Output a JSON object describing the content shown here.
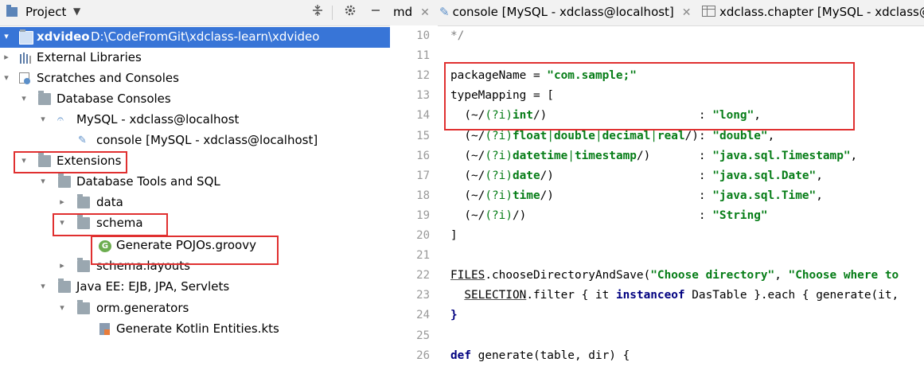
{
  "project_panel": {
    "title": "Project",
    "tree": [
      {
        "label": "xdvideo",
        "path": "D:\\CodeFromGit\\xdclass-learn\\xdvideo"
      },
      {
        "label": "External Libraries"
      },
      {
        "label": "Scratches and Consoles"
      },
      {
        "label": "Database Consoles"
      },
      {
        "label": "MySQL - xdclass@localhost"
      },
      {
        "label": "console [MySQL - xdclass@localhost]"
      },
      {
        "label": "Extensions"
      },
      {
        "label": "Database Tools and SQL"
      },
      {
        "label": "data"
      },
      {
        "label": "schema"
      },
      {
        "label": "Generate POJOs.groovy"
      },
      {
        "label": "schema.layouts"
      },
      {
        "label": "Java EE: EJB, JPA, Servlets"
      },
      {
        "label": "orm.generators"
      },
      {
        "label": "Generate Kotlin Entities.kts"
      }
    ],
    "icons": {
      "collapse_all": "collapse-all-icon",
      "settings": "gear-icon",
      "hide": "minimize-icon"
    }
  },
  "editor": {
    "tabs": [
      {
        "label": "md"
      },
      {
        "label": "console [MySQL - xdclass@localhost]"
      },
      {
        "label": "xdclass.chapter [MySQL - xdclass@"
      }
    ],
    "line_numbers": [
      "10",
      "11",
      "12",
      "13",
      "14",
      "15",
      "16",
      "17",
      "18",
      "19",
      "20",
      "21",
      "22",
      "23",
      "24",
      "25",
      "26"
    ],
    "code_lines": [
      [
        {
          "t": "*/",
          "c": "cm"
        }
      ],
      [],
      [
        {
          "t": "packageName = "
        },
        {
          "t": "\"com.sample;\"",
          "c": "str"
        }
      ],
      [
        {
          "t": "typeMapping = ["
        }
      ],
      [
        {
          "t": "  (~/"
        },
        {
          "t": "(?i)",
          "c": "rx"
        },
        {
          "t": "int",
          "c": "rxb"
        },
        {
          "t": "/)                      : "
        },
        {
          "t": "\"long\"",
          "c": "str"
        },
        {
          "t": ","
        }
      ],
      [
        {
          "t": "  (~/"
        },
        {
          "t": "(?i)",
          "c": "rx"
        },
        {
          "t": "float",
          "c": "rxb"
        },
        {
          "t": "|",
          "c": "rx"
        },
        {
          "t": "double",
          "c": "rxb"
        },
        {
          "t": "|",
          "c": "rx"
        },
        {
          "t": "decimal",
          "c": "rxb"
        },
        {
          "t": "|",
          "c": "rx"
        },
        {
          "t": "real",
          "c": "rxb"
        },
        {
          "t": "/): "
        },
        {
          "t": "\"double\"",
          "c": "str"
        },
        {
          "t": ","
        }
      ],
      [
        {
          "t": "  (~/"
        },
        {
          "t": "(?i)",
          "c": "rx"
        },
        {
          "t": "datetime",
          "c": "rxb"
        },
        {
          "t": "|",
          "c": "rx"
        },
        {
          "t": "timestamp",
          "c": "rxb"
        },
        {
          "t": "/)       : "
        },
        {
          "t": "\"java.sql.Timestamp\"",
          "c": "str"
        },
        {
          "t": ","
        }
      ],
      [
        {
          "t": "  (~/"
        },
        {
          "t": "(?i)",
          "c": "rx"
        },
        {
          "t": "date",
          "c": "rxb"
        },
        {
          "t": "/)                     : "
        },
        {
          "t": "\"java.sql.Date\"",
          "c": "str"
        },
        {
          "t": ","
        }
      ],
      [
        {
          "t": "  (~/"
        },
        {
          "t": "(?i)",
          "c": "rx"
        },
        {
          "t": "time",
          "c": "rxb"
        },
        {
          "t": "/)                     : "
        },
        {
          "t": "\"java.sql.Time\"",
          "c": "str"
        },
        {
          "t": ","
        }
      ],
      [
        {
          "t": "  (~/"
        },
        {
          "t": "(?i)",
          "c": "rx"
        },
        {
          "t": "/)                         : "
        },
        {
          "t": "\"String\"",
          "c": "str"
        }
      ],
      [
        {
          "t": "]"
        }
      ],
      [],
      [
        {
          "t": "FILES",
          "c": "ul"
        },
        {
          "t": ".chooseDirectoryAndSave("
        },
        {
          "t": "\"Choose directory\"",
          "c": "str"
        },
        {
          "t": ", "
        },
        {
          "t": "\"Choose where to",
          "c": "str"
        }
      ],
      [
        {
          "t": "  "
        },
        {
          "t": "SELECTION",
          "c": "ul"
        },
        {
          "t": ".filter { it "
        },
        {
          "t": "instanceof",
          "c": "kw"
        },
        {
          "t": " DasTable }.each { generate(it, "
        }
      ],
      [
        {
          "t": "}",
          "c": "kw"
        }
      ],
      [],
      [
        {
          "t": "def",
          "c": "kw"
        },
        {
          "t": " generate(table, dir) {"
        }
      ]
    ]
  }
}
